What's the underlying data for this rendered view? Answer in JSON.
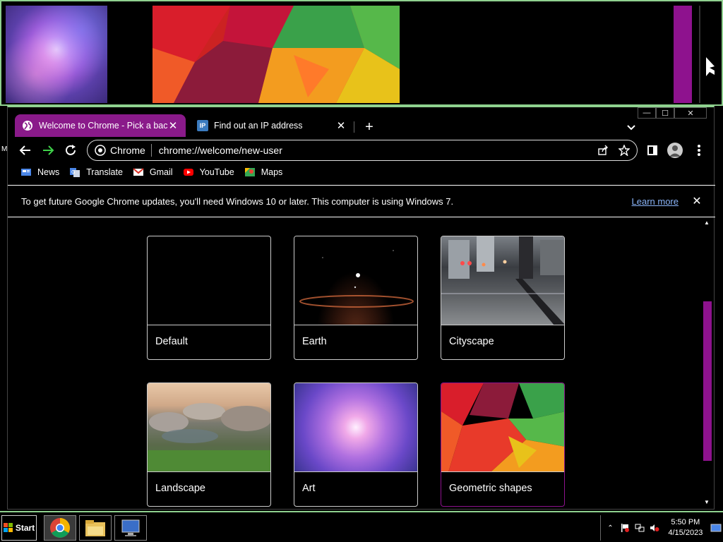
{
  "window": {
    "minimize_glyph": "—",
    "maximize_glyph": "☐",
    "close_glyph": "✕"
  },
  "tabs": [
    {
      "title": "Welcome to Chrome - Pick a background",
      "active": true,
      "close": "✕"
    },
    {
      "title": "Find out an IP address",
      "active": false,
      "close": "✕",
      "favicon_text": "IP"
    }
  ],
  "new_tab_glyph": "+",
  "omnibox": {
    "chip_label": "Chrome",
    "url": "chrome://welcome/new-user"
  },
  "bookmarks": [
    {
      "label": "News",
      "icon": "news-icon"
    },
    {
      "label": "Translate",
      "icon": "translate-icon"
    },
    {
      "label": "Gmail",
      "icon": "gmail-icon"
    },
    {
      "label": "YouTube",
      "icon": "youtube-icon"
    },
    {
      "label": "Maps",
      "icon": "maps-icon"
    }
  ],
  "infobar": {
    "message": "To get future Google Chrome updates, you'll need Windows 10 or later. This computer is using Windows 7.",
    "link": "Learn more",
    "close": "✕"
  },
  "backgrounds": [
    {
      "label": "Default"
    },
    {
      "label": "Earth"
    },
    {
      "label": "Cityscape"
    },
    {
      "label": "Landscape"
    },
    {
      "label": "Art"
    },
    {
      "label": "Geometric shapes"
    }
  ],
  "taskbar": {
    "start_label": "Start",
    "time": "5:50 PM",
    "date": "4/15/2023"
  },
  "colors": {
    "accent_purple": "#8e128e",
    "frame_green": "#8fd18f",
    "link_blue": "#8ab4f8"
  },
  "left_marker": "M"
}
